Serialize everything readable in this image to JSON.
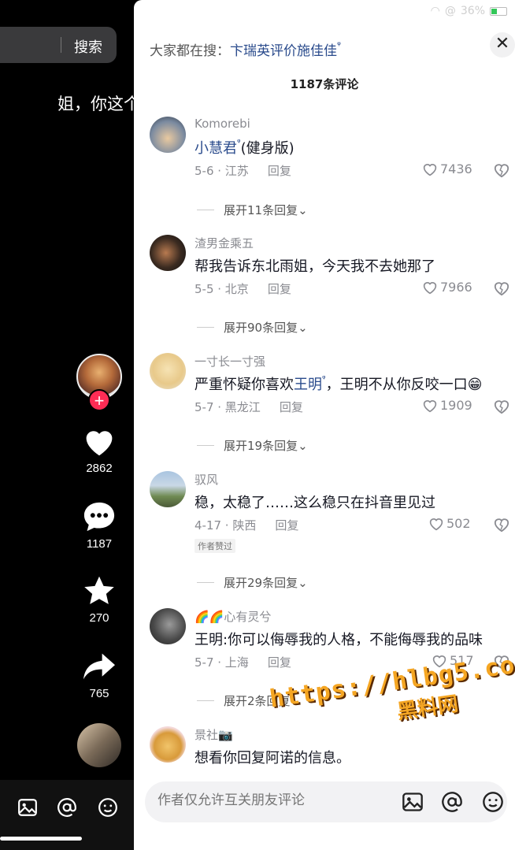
{
  "video": {
    "search_button": "搜索",
    "caption": "姐，你这个",
    "likes": "2862",
    "comments": "1187",
    "favorites": "270",
    "shares": "765",
    "icons": [
      "image-icon",
      "at-icon",
      "emoji-icon"
    ]
  },
  "statusbar": {
    "signal": "@",
    "battery": "36%"
  },
  "sheet": {
    "suggest_prefix": "大家都在搜：",
    "suggest_keyword": "卞瑞英评价施佳佳",
    "comment_count": "1187条评论",
    "close_icon": "close-icon"
  },
  "comments": [
    {
      "user": "Komorebi",
      "text_link": "小慧君",
      "text": "(健身版)",
      "date": "5-6 · 江苏",
      "reply": "回复",
      "likes": "7436",
      "expand": "展开11条回复"
    },
    {
      "user": "渣男金乘五",
      "text_link": "",
      "text": "帮我告诉东北雨姐，今天我不去她那了",
      "date": "5-5 · 北京",
      "reply": "回复",
      "likes": "7966",
      "expand": "展开90条回复"
    },
    {
      "user": "一寸长一寸强",
      "text_prefix": "严重怀疑你喜欢",
      "text_link": "王明",
      "text": "，王明不从你反咬一口😁",
      "date": "5-7 · 黑龙江",
      "reply": "回复",
      "likes": "1909",
      "expand": "展开19条回复"
    },
    {
      "user": "驭风",
      "text_link": "",
      "text": "稳，太稳了……这么稳只在抖音里见过",
      "date": "4-17 · 陕西",
      "reply": "回复",
      "likes": "502",
      "badge": "作者赞过",
      "expand": "展开29条回复"
    },
    {
      "user": "🌈🌈心有灵兮",
      "text_link": "",
      "text": "王明:你可以侮辱我的人格，不能侮辱我的品味",
      "date": "5-7 · 上海",
      "reply": "回复",
      "likes": "517",
      "expand": "展开2条回复"
    },
    {
      "user": "景社📷",
      "text_link": "",
      "text": "想看你回复阿诺的信息。"
    }
  ],
  "composer": {
    "placeholder": "作者仅允许互关朋友评论"
  },
  "watermark": {
    "url": "https://hlbg5.com",
    "name": "黑料网"
  },
  "colors": {
    "accent_red": "#fe2c55",
    "link_blue": "#2a4b8c",
    "watermark": "#f5a623"
  }
}
